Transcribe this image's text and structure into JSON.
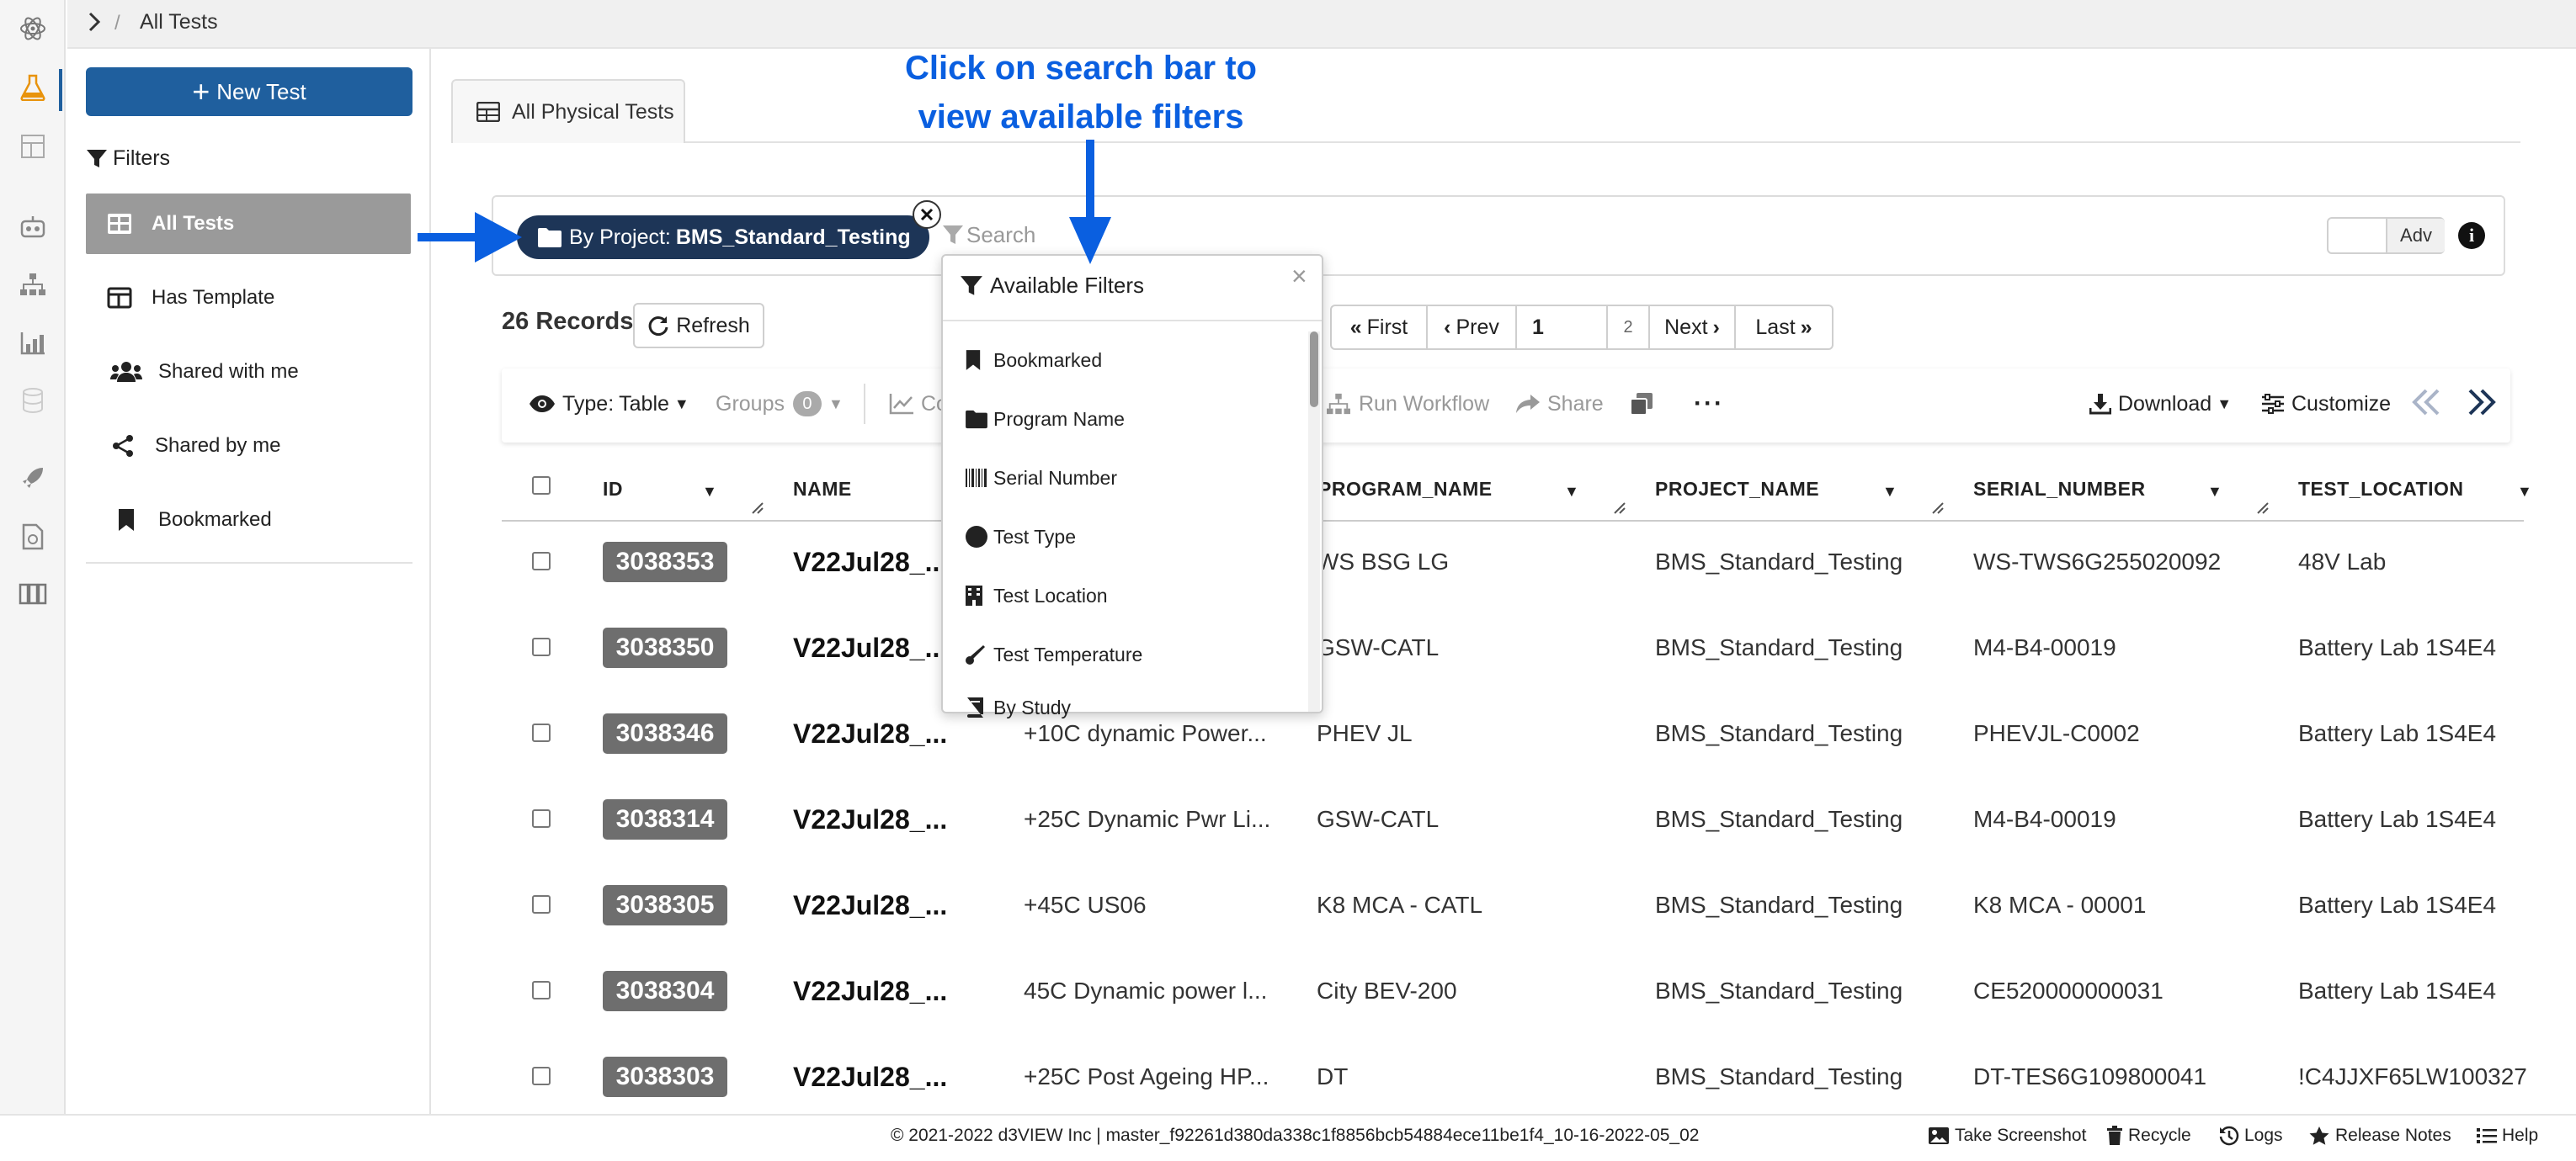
{
  "breadcrumb": {
    "current": "All Tests"
  },
  "sidebar": {
    "new_test_label": "New Test",
    "filters_label": "Filters",
    "items": [
      {
        "label": "All Tests",
        "active": true
      },
      {
        "label": "Has Template"
      },
      {
        "label": "Shared with me"
      },
      {
        "label": "Shared by me"
      },
      {
        "label": "Bookmarked"
      }
    ]
  },
  "main": {
    "tab_label": "All Physical Tests",
    "search": {
      "chip_prefix": "By Project: ",
      "chip_value": "BMS_Standard_Testing",
      "placeholder": "Search",
      "adv_label": "Adv"
    },
    "records_label": "26 Records",
    "refresh_label": "Refresh",
    "pagination": {
      "first": "First",
      "prev": "Prev",
      "page": "1",
      "total_pages": "2",
      "next": "Next",
      "last": "Last"
    },
    "toolbar": {
      "type_prefix": "Type:",
      "type_value": "Table",
      "groups_label": "Groups",
      "groups_count": "0",
      "co_label": "Co",
      "run_workflow": "Run Workflow",
      "share": "Share",
      "more": "···",
      "download": "Download",
      "customize": "Customize"
    },
    "table": {
      "columns": [
        "ID",
        "NAME",
        "PROGRAM_NAME",
        "PROJECT_NAME",
        "SERIAL_NUMBER",
        "TEST_LOCATION"
      ],
      "rows": [
        {
          "id": "3038353",
          "name": "V22Jul28_...",
          "desc": "",
          "program": "WS BSG LG",
          "project": "BMS_Standard_Testing",
          "serial": "WS-TWS6G255020092",
          "location": "48V Lab"
        },
        {
          "id": "3038350",
          "name": "V22Jul28_...",
          "desc": "",
          "program": "GSW-CATL",
          "project": "BMS_Standard_Testing",
          "serial": "M4-B4-00019",
          "location": "Battery Lab 1S4E4"
        },
        {
          "id": "3038346",
          "name": "V22Jul28_...",
          "desc": "+10C dynamic Power...",
          "program": "PHEV JL",
          "project": "BMS_Standard_Testing",
          "serial": "PHEVJL-C0002",
          "location": "Battery Lab 1S4E4"
        },
        {
          "id": "3038314",
          "name": "V22Jul28_...",
          "desc": "+25C Dynamic Pwr Li...",
          "program": "GSW-CATL",
          "project": "BMS_Standard_Testing",
          "serial": "M4-B4-00019",
          "location": "Battery Lab 1S4E4"
        },
        {
          "id": "3038305",
          "name": "V22Jul28_...",
          "desc": "+45C US06",
          "program": "K8 MCA - CATL",
          "project": "BMS_Standard_Testing",
          "serial": "K8 MCA - 00001",
          "location": "Battery Lab 1S4E4"
        },
        {
          "id": "3038304",
          "name": "V22Jul28_...",
          "desc": "45C Dynamic power l...",
          "program": "City BEV-200",
          "project": "BMS_Standard_Testing",
          "serial": "CE520000000031",
          "location": "Battery Lab 1S4E4"
        },
        {
          "id": "3038303",
          "name": "V22Jul28_...",
          "desc": "+25C Post Ageing HP...",
          "program": "DT",
          "project": "BMS_Standard_Testing",
          "serial": "DT-TES6G109800041",
          "location": "!C4JJXF65LW100327"
        }
      ]
    }
  },
  "available_filters": {
    "title": "Available Filters",
    "close": "×",
    "items": [
      {
        "label": "Bookmarked",
        "icon": "bookmark-icon"
      },
      {
        "label": "Program Name",
        "icon": "folder-icon"
      },
      {
        "label": "Serial Number",
        "icon": "barcode-icon"
      },
      {
        "label": "Test Type",
        "icon": "circle-icon"
      },
      {
        "label": "Test Location",
        "icon": "building-icon"
      },
      {
        "label": "Test Temperature",
        "icon": "thermometer-icon"
      },
      {
        "label": "By Study",
        "icon": "book-icon"
      }
    ]
  },
  "annotation": {
    "line1": "Click on search bar to",
    "line2": "view available filters",
    "color": "#0a5fe0"
  },
  "footer": {
    "copyright": "© 2021-2022 d3VIEW Inc | master_f92261d380da338c1f8856bcb54884ece11be1f4_10-16-2022-05_02",
    "take_screenshot": "Take Screenshot",
    "recycle": "Recycle",
    "logs": "Logs",
    "release_notes": "Release Notes",
    "help": "Help"
  },
  "colors": {
    "primary": "#1f5f9e",
    "chip": "#1d3557",
    "active_side": "#9a9a9a",
    "badge": "#6e6e6e"
  }
}
